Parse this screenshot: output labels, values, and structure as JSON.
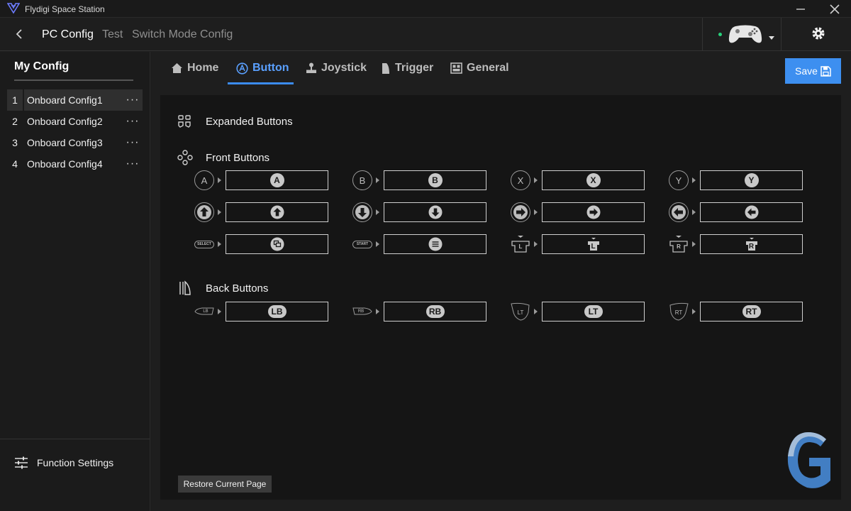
{
  "window": {
    "title": "Flydigi Space Station"
  },
  "nav": {
    "tabs": [
      {
        "label": "PC Config"
      },
      {
        "label": "Test"
      },
      {
        "label": "Switch Mode Config"
      }
    ]
  },
  "sidebar": {
    "heading": "My Config",
    "configs": [
      {
        "num": "1",
        "name": "Onboard Config1",
        "more": "···"
      },
      {
        "num": "2",
        "name": "Onboard Config2",
        "more": "···"
      },
      {
        "num": "3",
        "name": "Onboard Config3",
        "more": "···"
      },
      {
        "num": "4",
        "name": "Onboard Config4",
        "more": "···"
      }
    ],
    "function_settings": "Function Settings"
  },
  "tabs": [
    {
      "label": "Home",
      "icon": "home-icon"
    },
    {
      "label": "Button",
      "icon": "button-a-icon"
    },
    {
      "label": "Joystick",
      "icon": "joystick-icon"
    },
    {
      "label": "Trigger",
      "icon": "trigger-icon"
    },
    {
      "label": "General",
      "icon": "general-icon"
    }
  ],
  "save_label": "Save",
  "sections": {
    "expanded": "Expanded Buttons",
    "front": "Front Buttons",
    "back": "Back Buttons"
  },
  "mappings": {
    "front_row1": [
      {
        "src": "A",
        "dst": "A"
      },
      {
        "src": "B",
        "dst": "B"
      },
      {
        "src": "X",
        "dst": "X"
      },
      {
        "src": "Y",
        "dst": "Y"
      }
    ],
    "front_row3": [
      {
        "src": "SELECT"
      },
      {
        "src": "START"
      },
      {
        "src": "L",
        "dst": "L"
      },
      {
        "src": "R",
        "dst": "R"
      }
    ],
    "back_row": [
      {
        "src": "LB",
        "dst": "LB"
      },
      {
        "src": "RB",
        "dst": "RB"
      },
      {
        "src": "LT",
        "dst": "LT"
      },
      {
        "src": "RT",
        "dst": "RT"
      }
    ]
  },
  "restore_label": "Restore Current Page",
  "colors": {
    "accent": "#3d8ff0",
    "active_tab": "#5aa0ff",
    "connected": "#27d07a"
  }
}
